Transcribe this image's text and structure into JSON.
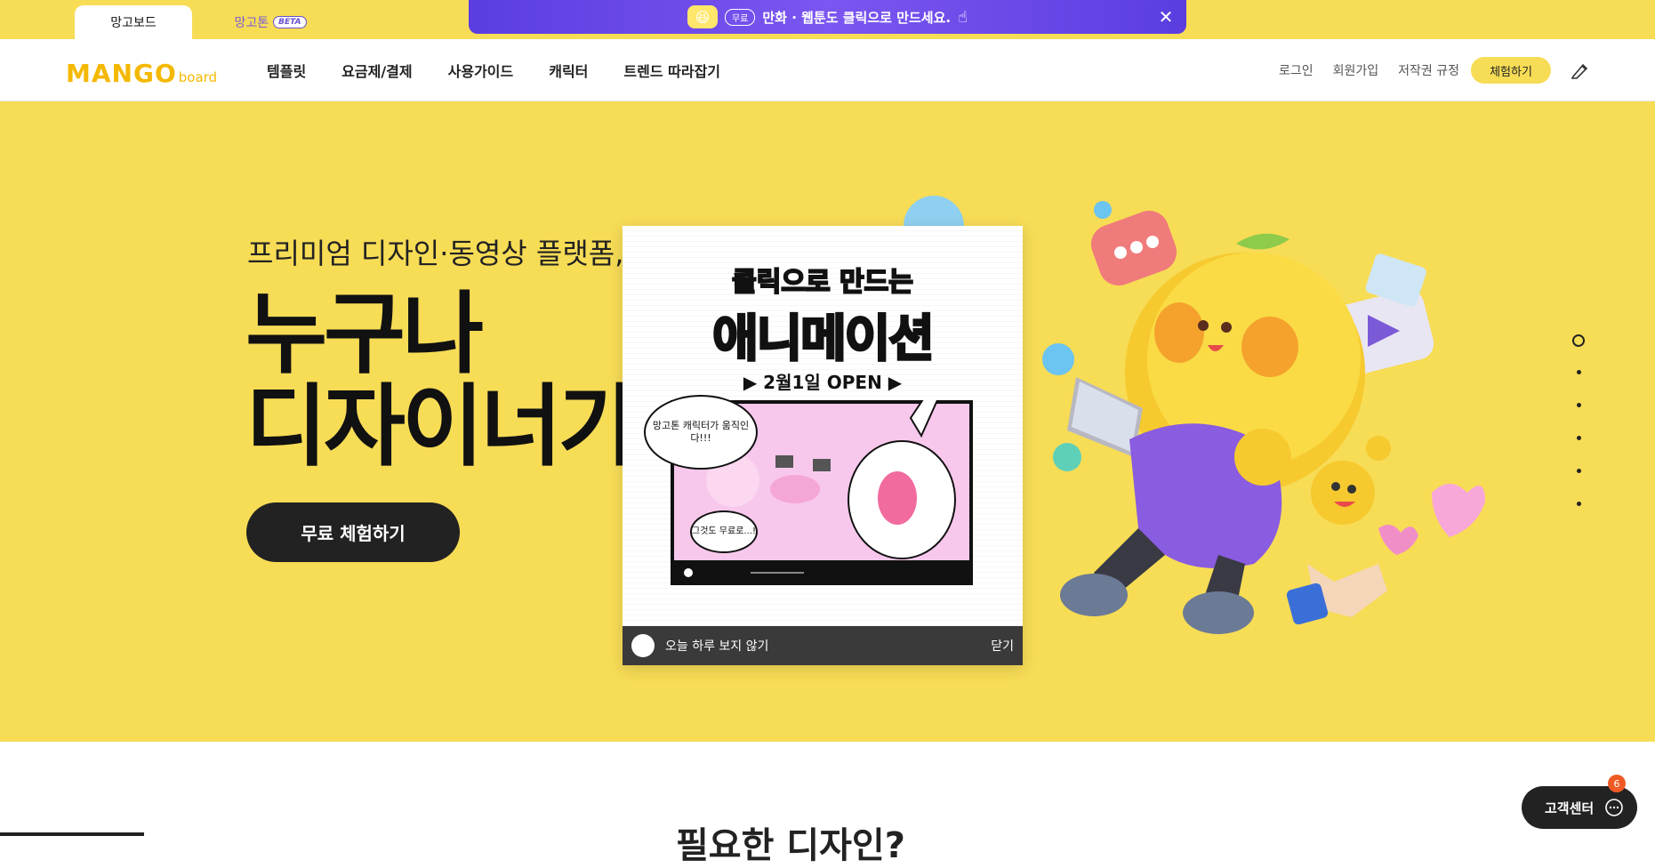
{
  "tabs": [
    {
      "label": "망고보드"
    },
    {
      "label": "망고톤",
      "badge": "BETA"
    }
  ],
  "promo": {
    "free_tag": "무료",
    "text": "만화 · 웹툰도 클릭으로 만드세요.",
    "close_icon": "close-icon"
  },
  "logo": {
    "main": "MANGO",
    "sub": "board"
  },
  "nav": [
    "템플릿",
    "요금제/결제",
    "사용가이드",
    "캐릭터",
    "트렌드 따라잡기"
  ],
  "util": {
    "login": "로그인",
    "signup": "회원가입",
    "copyright": "저작권 규정",
    "trial": "체험하기"
  },
  "hero": {
    "subtitle": "프리미엄 디자인·동영상 플랫폼, 망",
    "title_line1": "누구나",
    "title_line2": "디자이너가 될",
    "cta": "무료 체험하기"
  },
  "popup": {
    "title_pink": "클릭",
    "title_rest": "으로 만드는",
    "headline": "애니메이션",
    "open_date": "2월1일 OPEN",
    "bubble1": "망고톤 캐릭터가 움직인다!!!",
    "bubble2": "그것도 무료로...!",
    "dont_show": "오늘 하루 보지 않기",
    "close": "닫기"
  },
  "support": {
    "label": "고객센터",
    "badge": "6"
  },
  "below_title": "필요한 디자인?",
  "colors": {
    "brand_yellow": "#f7dc56",
    "promo_purple": "#6a4fe6",
    "dark": "#222222",
    "badge_orange": "#ef5a24"
  }
}
